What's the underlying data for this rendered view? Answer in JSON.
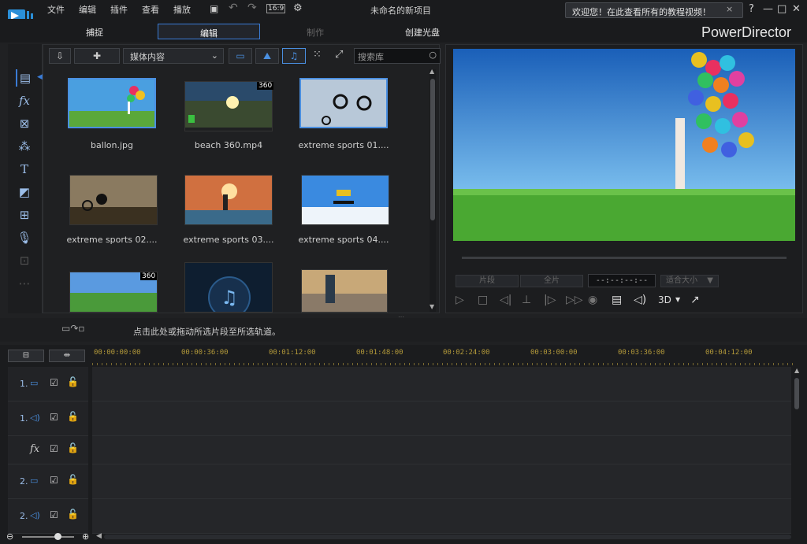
{
  "menu": [
    "文件",
    "编辑",
    "插件",
    "查看",
    "播放"
  ],
  "aspect_ratio": "16:9",
  "project_title": "未命名的新项目",
  "welcome_text": "欢迎您！在此查看所有的教程视频！",
  "welcome_close": "×",
  "window_buttons": [
    "?",
    "—",
    "□",
    "✕"
  ],
  "mode_tabs": [
    "捕捉",
    "编辑",
    "制作",
    "创建光盘"
  ],
  "brand": "PowerDirector",
  "library": {
    "dropdown": "媒体内容",
    "search_placeholder": "搜索库",
    "items": [
      {
        "label": "ballon.jpg",
        "badge": ""
      },
      {
        "label": "beach 360.mp4",
        "badge": "360"
      },
      {
        "label": "extreme sports 01....",
        "badge": ""
      },
      {
        "label": "extreme sports 02....",
        "badge": ""
      },
      {
        "label": "extreme sports 03....",
        "badge": ""
      },
      {
        "label": "extreme sports 04....",
        "badge": ""
      },
      {
        "label": "",
        "badge": "360"
      },
      {
        "label": "",
        "badge": ""
      },
      {
        "label": "",
        "badge": ""
      }
    ]
  },
  "preview": {
    "clip_label": "片段",
    "full_label": "全片",
    "timecode": "--:--:--:--",
    "fit_label": "适合大小",
    "mode_3d": "3D"
  },
  "hint": "点击此处或拖动所选片段至所选轨道。",
  "ruler_ticks": [
    "00:00:00:00",
    "00:00:36:00",
    "00:01:12:00",
    "00:01:48:00",
    "00:02:24:00",
    "00:03:00:00",
    "00:03:36:00",
    "00:04:12:00"
  ],
  "tracks": [
    {
      "num": "1.",
      "kind": "video"
    },
    {
      "num": "1.",
      "kind": "audio"
    },
    {
      "num": "",
      "kind": "fx"
    },
    {
      "num": "2.",
      "kind": "video"
    },
    {
      "num": "2.",
      "kind": "audio"
    }
  ],
  "colors": {
    "accent": "#3a7bd5",
    "ruler": "#b49a3a",
    "icon": "#9bbde8"
  }
}
